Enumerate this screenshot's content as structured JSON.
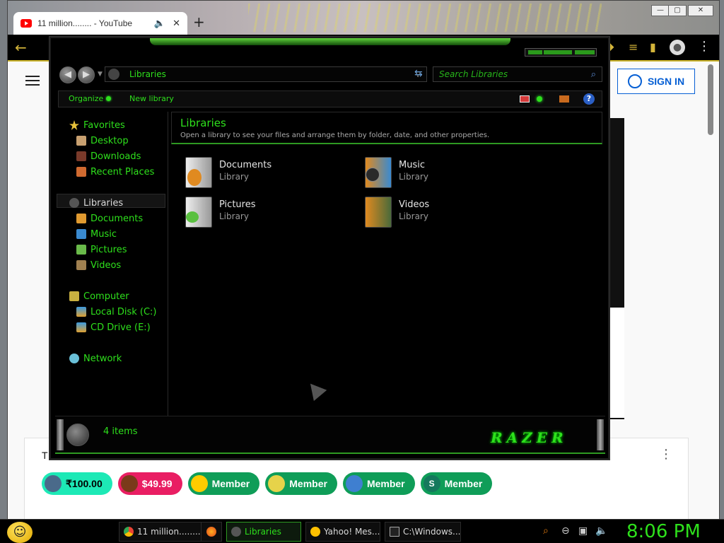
{
  "browser": {
    "tab_title": "11 million........ - YouTube",
    "tab_audio_icon": "speaker-icon",
    "sign_in": "SIGN IN",
    "chat_header_initial": "T",
    "chips": [
      {
        "label": "₹100.00",
        "color": "#1de9b6",
        "text_color": "#000000"
      },
      {
        "label": "$49.99",
        "color": "#e91e63",
        "text_color": "#ffffff"
      },
      {
        "label": "Member",
        "color": "#0f9d58",
        "text_color": "#ffffff"
      },
      {
        "label": "Member",
        "color": "#0f9d58",
        "text_color": "#ffffff"
      },
      {
        "label": "Member",
        "color": "#0f9d58",
        "text_color": "#ffffff"
      },
      {
        "label": "Member",
        "color": "#0f9d58",
        "text_color": "#ffffff",
        "avatar": "S"
      }
    ]
  },
  "explorer": {
    "address": "Libraries",
    "search_placeholder": "Search Libraries",
    "commands": {
      "organize": "Organize",
      "new_library": "New library"
    },
    "nav": {
      "favorites": "Favorites",
      "desktop": "Desktop",
      "downloads": "Downloads",
      "recent": "Recent Places",
      "libraries": "Libraries",
      "documents": "Documents",
      "music": "Music",
      "pictures": "Pictures",
      "videos": "Videos",
      "computer": "Computer",
      "local_disk": "Local Disk (C:)",
      "cd_drive": "CD Drive (E:)",
      "network": "Network"
    },
    "header": {
      "title": "Libraries",
      "subtitle": "Open a library to see your files and arrange them by folder, date, and other properties."
    },
    "libraries": [
      {
        "name": "Documents",
        "type": "Library"
      },
      {
        "name": "Music",
        "type": "Library"
      },
      {
        "name": "Pictures",
        "type": "Library"
      },
      {
        "name": "Videos",
        "type": "Library"
      }
    ],
    "status": "4 items",
    "brand": "RAZER",
    "accent": "#2ee01c"
  },
  "taskbar": {
    "tasks": [
      {
        "label": "11 million........"
      },
      {
        "label": "Libraries"
      },
      {
        "label": "Yahoo! Mes..."
      },
      {
        "label": "C:\\Windows..."
      }
    ],
    "clock": "8:06 PM"
  }
}
